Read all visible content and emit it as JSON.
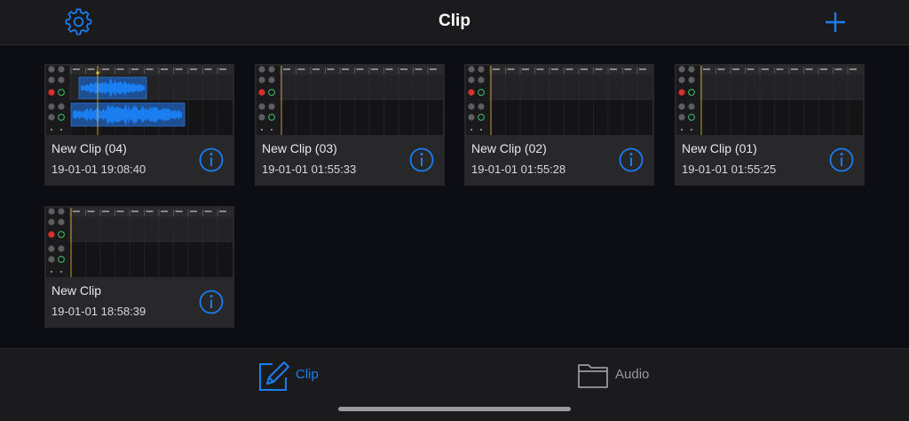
{
  "header": {
    "title": "Clip",
    "settings_icon": "gear-icon",
    "add_icon": "plus-icon"
  },
  "clips": [
    {
      "name": "New Clip (04)",
      "date": "19-01-01 19:08:40",
      "has_audio": true
    },
    {
      "name": "New Clip (03)",
      "date": "19-01-01 01:55:33",
      "has_audio": false
    },
    {
      "name": "New Clip (02)",
      "date": "19-01-01 01:55:28",
      "has_audio": false
    },
    {
      "name": "New Clip (01)",
      "date": "19-01-01 01:55:25",
      "has_audio": false
    },
    {
      "name": "New Clip",
      "date": "19-01-01 18:58:39",
      "has_audio": false
    }
  ],
  "tabs": [
    {
      "label": "Clip",
      "icon": "edit-icon",
      "active": true
    },
    {
      "label": "Audio",
      "icon": "folder-icon",
      "active": false
    }
  ],
  "colors": {
    "accent": "#1a7ef0",
    "background": "#0d0e13",
    "bar": "#1b1b1e",
    "card": "#28282b",
    "inactive_tab": "#9a9a9e"
  }
}
